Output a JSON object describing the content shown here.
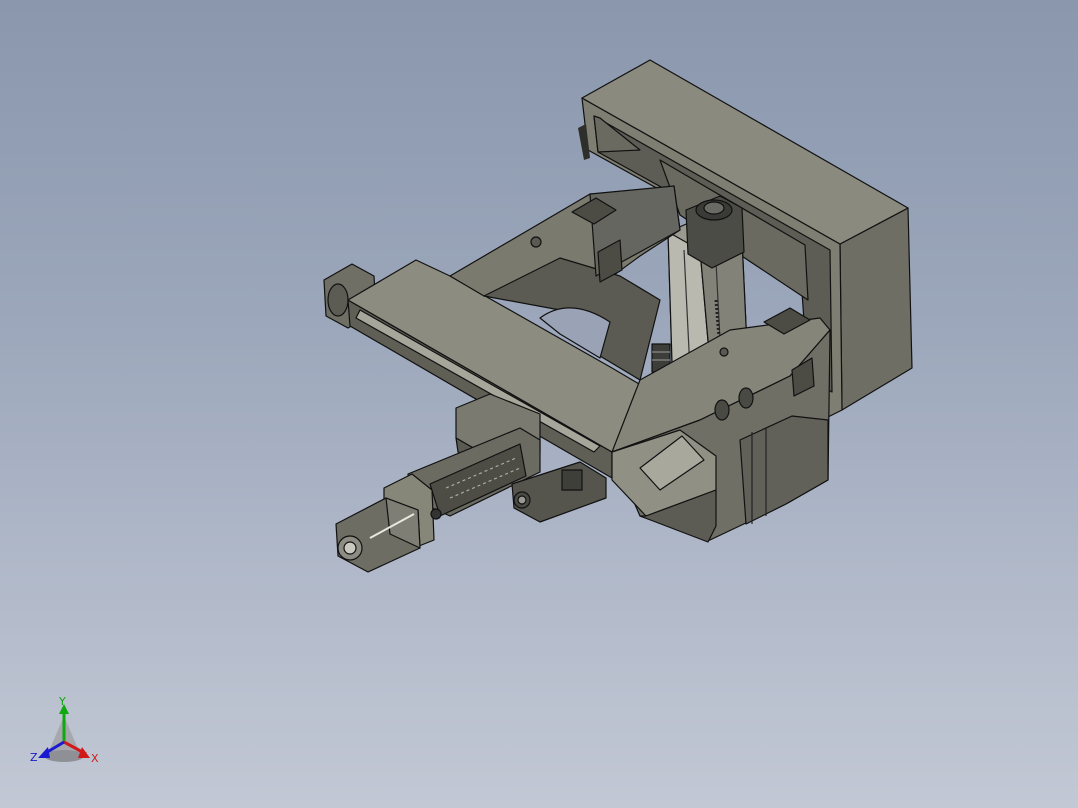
{
  "viewport": {
    "background_top": "#8a97ad",
    "background_bottom": "#c2c8d4"
  },
  "model": {
    "body_color": "#7b7b70",
    "dark_face_color": "#5c5c54",
    "light_face_color": "#8e8e82",
    "edge_color": "#111111"
  },
  "triad": {
    "x_label": "X",
    "y_label": "Y",
    "z_label": "Z",
    "x_color": "#d01a1a",
    "y_color": "#0fa80f",
    "z_color": "#1a1ad0"
  }
}
